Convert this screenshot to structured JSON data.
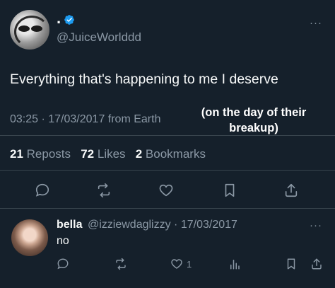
{
  "tweet": {
    "display_name": ".",
    "handle": "@JuiceWorlddd",
    "text": "Everything that's happening to me I deserve",
    "meta": "03:25 · 17/03/2017 from Earth",
    "stats": {
      "reposts_count": "21",
      "reposts_label": "Reposts",
      "likes_count": "72",
      "likes_label": "Likes",
      "bookmarks_count": "2",
      "bookmarks_label": "Bookmarks"
    },
    "more": "···"
  },
  "annotation": {
    "line1": "(on the day of their",
    "line2": "breakup)"
  },
  "reply": {
    "display_name": "bella",
    "handle_date": "@izziewdaglizzy · 17/03/2017",
    "text": "no",
    "like_count": "1",
    "more": "···"
  },
  "colors": {
    "background": "#15202b",
    "verified": "#1d9bf0",
    "secondary_text": "#8b98a5",
    "divider": "#38444d"
  },
  "icons": [
    "verified-badge-icon",
    "more-icon",
    "reply-icon",
    "repost-icon",
    "like-icon",
    "bookmark-icon",
    "share-icon",
    "analytics-icon"
  ]
}
